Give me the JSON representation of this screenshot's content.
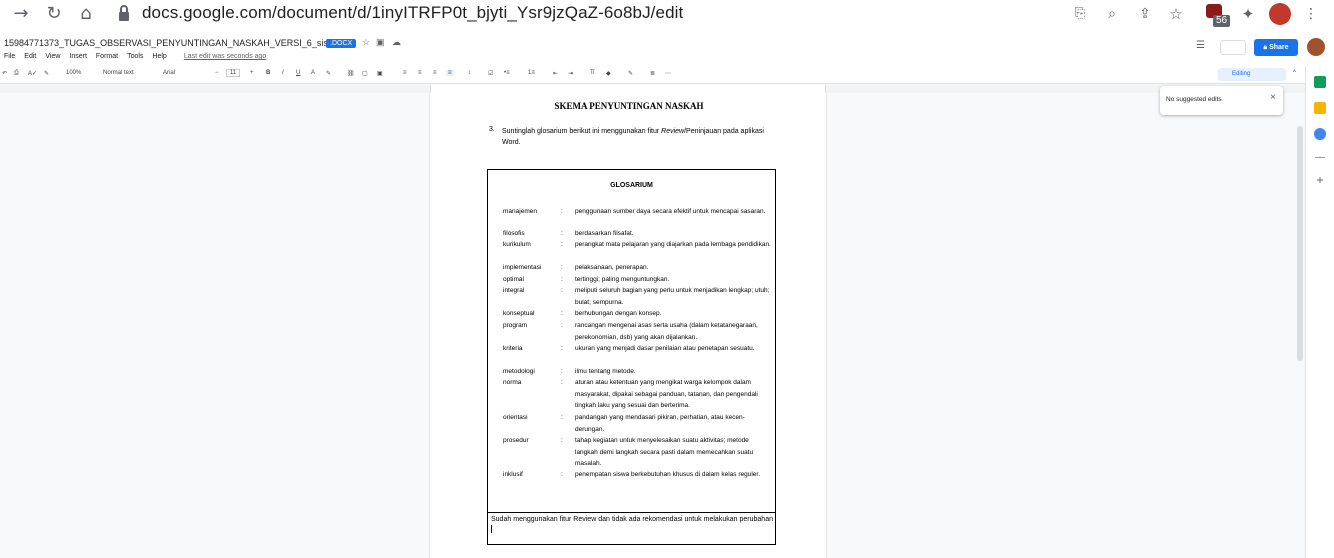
{
  "browser": {
    "url": "docs.google.com/document/d/1inyITRFP0t_bjyti_Ysr9jzQaZ-6o8bJ/edit",
    "ext_badge": "56"
  },
  "doc": {
    "title": "15984771373_TUGAS_OBSERVASI_PENYUNTINGAN_NASKAH_VERSI_6_sistem",
    "badge": ".DOCX",
    "menu": [
      "File",
      "Edit",
      "View",
      "Insert",
      "Format",
      "Tools",
      "Help"
    ],
    "last_edit": "Last edit was seconds ago",
    "share_label": "Share"
  },
  "toolbar": {
    "zoom": "100%",
    "style": "Normal text",
    "font": "Arial",
    "font_size": "11",
    "mode": "Editing"
  },
  "page": {
    "heading": "SKEMA PENYUNTINGAN NASKAH",
    "instruction_num": "3.",
    "instruction_pre": "Suntinglah glosarium berikut ini menggunakan fitur ",
    "instruction_em": "Review",
    "instruction_post": "/Peninjauan pada aplikasi Word.",
    "glossary_title": "GLOSARIUM",
    "glossary": [
      {
        "term": "manajemen",
        "def": "penggunaan sumber daya secara efektif untuk mencapai sasaran."
      },
      {
        "term": "filosofis",
        "def": "berdasarkan filsafat."
      },
      {
        "term": "kurikulum",
        "def": "perangkat mata pelajaran yang diajarkan pada lembaga pendidikan."
      },
      {
        "term": "implementasi",
        "def": "pelaksanaan, penerapan."
      },
      {
        "term": "optimal",
        "def": "tertinggi; paling menguntungkan."
      },
      {
        "term": "integral",
        "def": "meliputi seluruh bagian yang perlu untuk menjadikan lengkap; utuh; bulat; sempurna."
      },
      {
        "term": "konseptual",
        "def": "berhubungan dengan konsep."
      },
      {
        "term": "program",
        "def": "rancangan mengenai asas serta usaha (dalam ketatanegaraan, perekonomian, dsb) yang akan dijalankan."
      },
      {
        "term": "kriteria",
        "def": "ukuran yang menjadi dasar penilaian atau penetapan sesuatu."
      },
      {
        "term": "metodologi",
        "def": "ilmu tentang metode."
      },
      {
        "term": "norma",
        "def": "aturan atau ketentuan yang mengikat warga kelompok dalam masyarakat, dipakai sebagai panduan, tatanan, dan pengendali tingkah laku yang sesuai dan berterima."
      },
      {
        "term": "orientasi",
        "def": "pandangan yang mendasari pikiran, perhatian, atau kecen-derungan."
      },
      {
        "term": "prosedur",
        "def": "tahap kegiatan untuk menyelesaikan suatu aktivitas; metode langkah demi langkah secara pasti dalam memecahkan suatu masalah."
      },
      {
        "term": "inklusif",
        "def": "penempatan siswa berkebutuhan khusus di dalam kelas reguler."
      }
    ],
    "note": "Sudah menggunakan fitur Review dan tidak ada rekomendasi untuk melakukan perubahan"
  },
  "suggest": {
    "text": "No suggested edits"
  }
}
